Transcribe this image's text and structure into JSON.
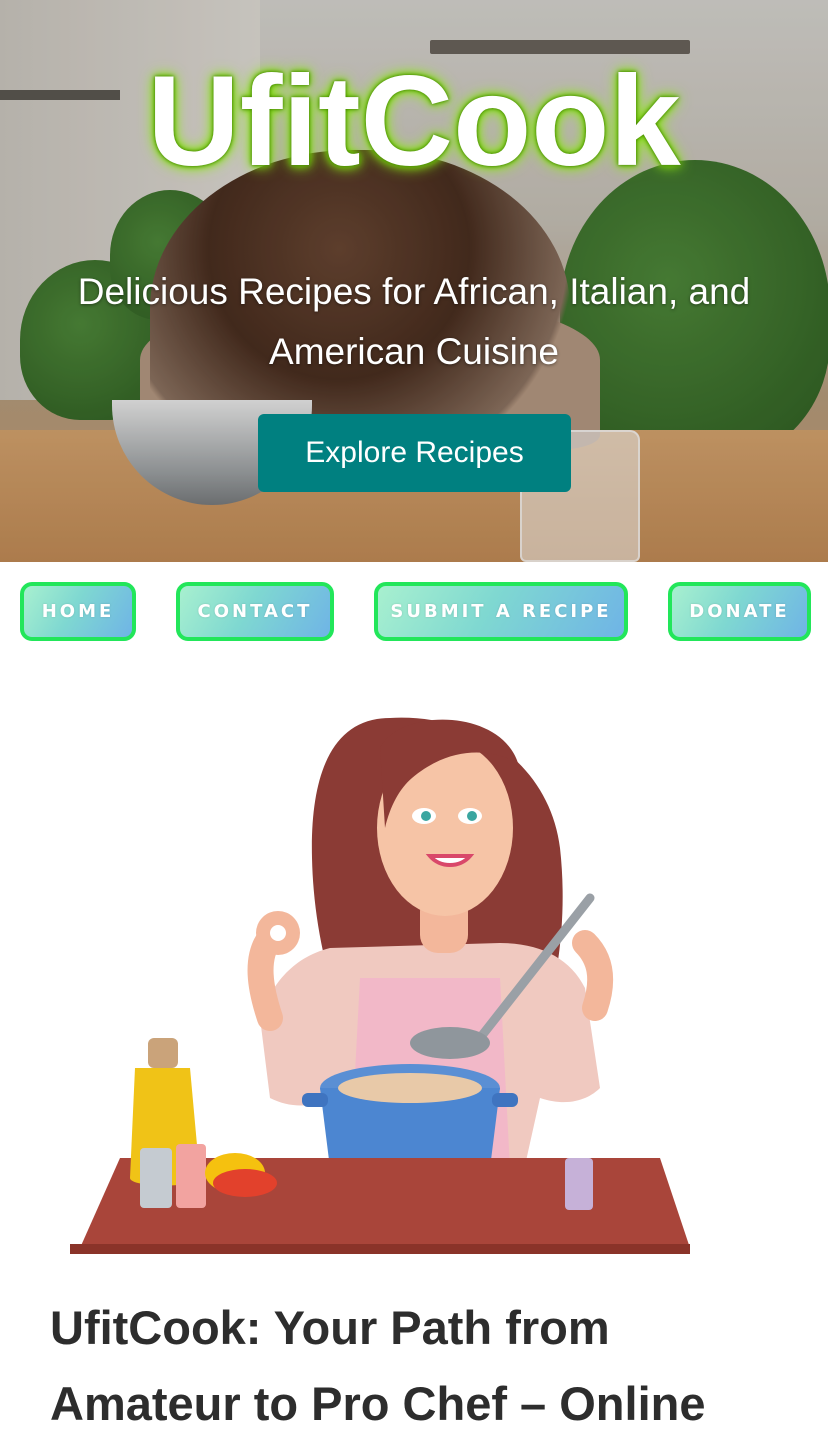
{
  "hero": {
    "brand": "UfitCook",
    "tagline": "Delicious Recipes for African, Italian, and American Cuisine",
    "cta_label": "Explore Recipes"
  },
  "nav": {
    "items": [
      {
        "label": "HOME"
      },
      {
        "label": "CONTACT"
      },
      {
        "label": "SUBMIT A RECIPE"
      },
      {
        "label": "DONATE"
      }
    ]
  },
  "article": {
    "title": "UfitCook: Your Path from Amateur to Pro Chef – Online"
  },
  "colors": {
    "cta_bg": "#008080",
    "nav_border": "#22e65a",
    "brand_glow": "#7fdc12",
    "title_text": "#2d2d2d"
  },
  "icons": {
    "hero_image": "kitchen-photo",
    "illustration": "chef-woman-cooking"
  }
}
